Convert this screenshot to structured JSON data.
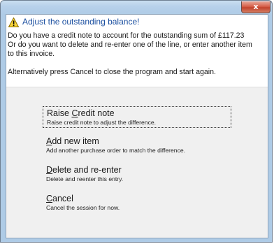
{
  "window": {
    "close_label": "x"
  },
  "header": {
    "icon": "warning-icon",
    "instruction": "Adjust the outstanding balance!"
  },
  "content": {
    "line1": "Do you have a credit note to account for the outstanding sum of £117.23",
    "line2": "Or do you want to delete and re-enter one of the line, or enter another item",
    "line3": "to this invoice.",
    "line4": "Alternatively press Cancel to close the program and start again."
  },
  "commands": [
    {
      "pre": "Raise ",
      "accel": "C",
      "post": "redit note",
      "desc": "Raise credit note to adjust the difference."
    },
    {
      "pre": "",
      "accel": "A",
      "post": "dd new item",
      "desc": "Add another purchase order to match the difference."
    },
    {
      "pre": "",
      "accel": "D",
      "post": "elete and re-enter",
      "desc": "Delete and reenter this entry."
    },
    {
      "pre": "",
      "accel": "C",
      "post": "ancel",
      "desc": "Cancel the session for now."
    }
  ],
  "colors": {
    "instruction": "#1b4fa0",
    "frame": "#aecbe6",
    "close_button": "#c2432d",
    "lower_area": "#f0f0f0"
  }
}
